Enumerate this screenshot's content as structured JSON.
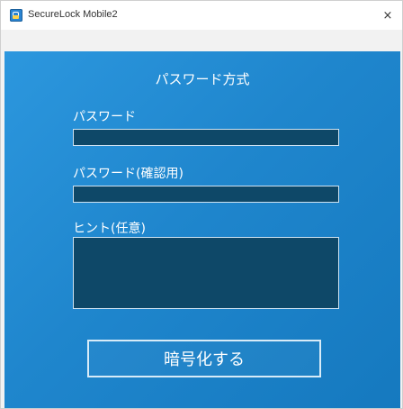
{
  "window": {
    "title": "SecureLock Mobile2",
    "close_label": "×",
    "app_icon": "padlock-app-icon"
  },
  "panel": {
    "heading": "パスワード方式",
    "fields": [
      {
        "label": "パスワード",
        "value": ""
      },
      {
        "label": "パスワード(確認用)",
        "value": ""
      },
      {
        "label": "ヒント(任意)",
        "value": ""
      }
    ],
    "submit_label": "暗号化する"
  },
  "colors": {
    "panel_blue": "#1f86cd",
    "field_dark": "#0e4868"
  }
}
